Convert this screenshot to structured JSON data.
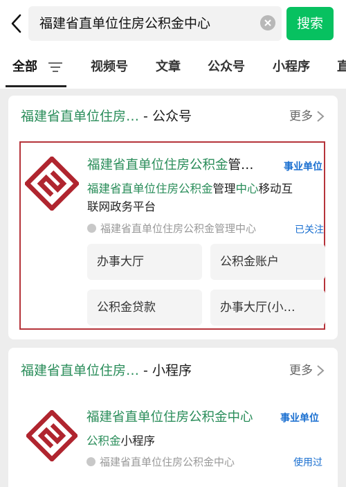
{
  "search": {
    "query": "福建省直单位住房公积金中心",
    "button_label": "搜索"
  },
  "tabs": [
    {
      "label": "全部"
    },
    {
      "label": "视频号"
    },
    {
      "label": "文章"
    },
    {
      "label": "公众号"
    },
    {
      "label": "小程序"
    },
    {
      "label": "直"
    }
  ],
  "official_account_section": {
    "title_highlight": "福建省直单位住房…",
    "title_suffix": " - 公众号",
    "more_label": "更多",
    "result": {
      "name_highlight": "福建省直单位住房公积金",
      "name_rest": "管…",
      "badge": "事业单位",
      "desc_part1": "福建省直单位住房公积金",
      "desc_part2": "管理",
      "desc_part3": "中心",
      "desc_part4": "移动互",
      "desc_line2": "联网政务平台",
      "verified_org": "福建省直单位住房公积金管理中心",
      "status": "已关注",
      "services": [
        "办事大厅",
        "公积金账户",
        "公积金贷款",
        "办事大厅(小…"
      ]
    }
  },
  "mini_program_section": {
    "title_highlight": "福建省直单位住房…",
    "title_suffix": " - 小程序",
    "more_label": "更多",
    "result": {
      "name_highlight": "福建省直单位住房公积金中心",
      "badge": "事业单位",
      "desc_highlight": "公积金",
      "desc_rest": "小程序",
      "verified_org": "福建省直单位住房公积金中心",
      "status": "使用过"
    }
  },
  "colors": {
    "accent_green": "#07c160",
    "highlight_green": "#2a8d5a",
    "link_blue": "#1a6fd0",
    "logo_red": "#b0252f",
    "outline_red": "#b5333a"
  },
  "icons": [
    "back-arrow-icon",
    "clear-icon",
    "filter-icon",
    "chevron-right-icon",
    "verified-icon",
    "housing-fund-logo-icon"
  ]
}
